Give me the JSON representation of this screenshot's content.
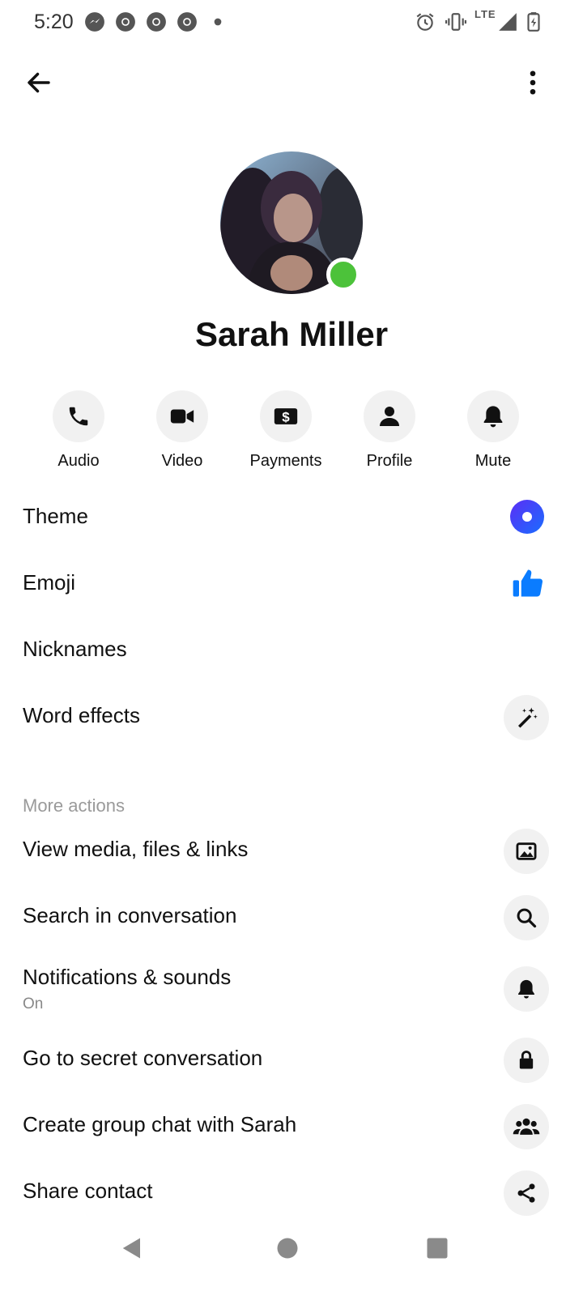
{
  "status_bar": {
    "time": "5:20",
    "network": "LTE",
    "left_icons": [
      "messenger-icon",
      "chrome-icon",
      "chrome-icon",
      "chrome-icon",
      "dot-icon"
    ],
    "right_icons": [
      "alarm-icon",
      "vibrate-icon",
      "lte-icon",
      "signal-icon",
      "battery-charging-icon"
    ]
  },
  "top_bar": {
    "back_icon": "arrow-left-icon",
    "more_icon": "more-vertical-icon"
  },
  "profile": {
    "name": "Sarah Miller",
    "online": true,
    "presence_color": "#4cc23a"
  },
  "quick_actions": [
    {
      "label": "Audio",
      "icon": "phone-icon"
    },
    {
      "label": "Video",
      "icon": "video-camera-icon"
    },
    {
      "label": "Payments",
      "icon": "dollar-icon"
    },
    {
      "label": "Profile",
      "icon": "person-icon"
    },
    {
      "label": "Mute",
      "icon": "bell-icon"
    }
  ],
  "settings": [
    {
      "label": "Theme",
      "icon": "theme-icon"
    },
    {
      "label": "Emoji",
      "icon": "thumbs-up-icon"
    },
    {
      "label": "Nicknames"
    },
    {
      "label": "Word effects",
      "icon": "magic-wand-icon"
    }
  ],
  "more_actions": {
    "header": "More actions",
    "items": [
      {
        "label": "View media, files & links",
        "icon": "image-icon"
      },
      {
        "label": "Search in conversation",
        "icon": "search-icon"
      },
      {
        "label": "Notifications & sounds",
        "sublabel": "On",
        "icon": "bell-icon"
      },
      {
        "label": "Go to secret conversation",
        "icon": "lock-icon"
      },
      {
        "label": "Create group chat with Sarah",
        "icon": "group-icon"
      },
      {
        "label": "Share contact",
        "icon": "share-icon"
      }
    ]
  },
  "nav_bar": {
    "icons": [
      "nav-back-icon",
      "nav-home-icon",
      "nav-recents-icon"
    ]
  },
  "colors": {
    "accent_blue": "#0a7cff",
    "theme_gradient_start": "#5b2ef5",
    "theme_gradient_end": "#1a6dff"
  }
}
